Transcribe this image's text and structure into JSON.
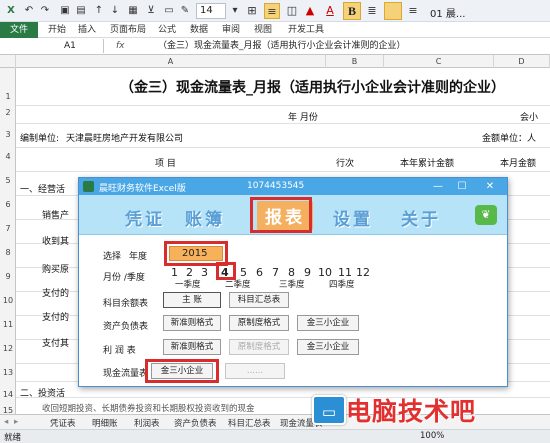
{
  "qat": {
    "font_size": "14",
    "doc_title": "01 晨..."
  },
  "ribbon": {
    "tabs": [
      "文件",
      "开始",
      "插入",
      "页面布局",
      "公式",
      "数据",
      "审阅",
      "视图",
      "开发工具"
    ]
  },
  "formula_bar": {
    "cell": "A1",
    "fx": "fx",
    "content": "（金三）现金流量表_月报（适用执行小企业会计准则的企业）"
  },
  "columns": [
    "A",
    "B",
    "C",
    "D"
  ],
  "rows": [
    "1",
    "2",
    "3",
    "4",
    "5",
    "6",
    "7",
    "8",
    "9",
    "10",
    "11",
    "12",
    "13",
    "14",
    "15"
  ],
  "sheet": {
    "title": "（金三）现金流量表_月报（适用执行小企业会计准则的企业）",
    "year_month": "年    月份",
    "hui_label": "会小",
    "unit_label": "编制单位:",
    "company": "天津晨旺房地产开发有限公司",
    "amount_unit": "金额单位：人",
    "col_item": "项    目",
    "col_row": "行次",
    "col_ytd": "本年累计金额",
    "col_month": "本月金额",
    "sec1": "一、经营活",
    "r1": "销售产",
    "r2": "收到其",
    "r3": "购买原",
    "r4": "支付的",
    "r5": "支付的",
    "r6": "支付其",
    "sec2": "二、投资活",
    "r7": "收回短期投资、长期债券投资和长期股权投资收到的现金"
  },
  "sheet_tabs": [
    "凭证表",
    "明细账",
    "利润表",
    "资产负债表",
    "科目汇总表",
    "现金流量表"
  ],
  "status": {
    "ready": "就绪",
    "zoom": "100%"
  },
  "dialog": {
    "title": "晨旺财务软件Excel版",
    "serial": "1074453545",
    "menu": {
      "voucher": "凭证",
      "ledger": "账簿",
      "reports": "报表",
      "settings": "设置",
      "about": "关于"
    },
    "select_label": "选择",
    "year_label": "年度",
    "year": "2015",
    "month_label": "月份 /季度",
    "months": [
      "1",
      "2",
      "3",
      "4",
      "5",
      "6",
      "7",
      "8",
      "9",
      "10",
      "11",
      "12"
    ],
    "quarters": [
      "一季度",
      "二季度",
      "三季度",
      "四季度"
    ],
    "account_balance_label": "科目余额表",
    "account_balance_btn": "主    账",
    "account_summary_btn": "科目汇总表",
    "balance_sheet_label": "资产负债表",
    "new_std_btn": "新准则格式",
    "old_std_btn": "原制度格式",
    "gold3_btn": "金三小企业",
    "profit_label": "利    润    表",
    "profit_new_btn": "新准则格式",
    "profit_old_btn": "原制度格式",
    "profit_gold3_btn": "金三小企业",
    "cashflow_label": "现金流量表",
    "cashflow_gold3_btn": "金三小企业",
    "cashflow_extra_btn": "......"
  },
  "watermark": {
    "text": "电脑技术吧"
  },
  "colors": {
    "excel_green": "#2a7a46",
    "dialog_blue": "#4aa7e6",
    "menu_bg": "#b6e3f7",
    "highlight": "#d92c2c",
    "orange": "#f7b15a"
  }
}
